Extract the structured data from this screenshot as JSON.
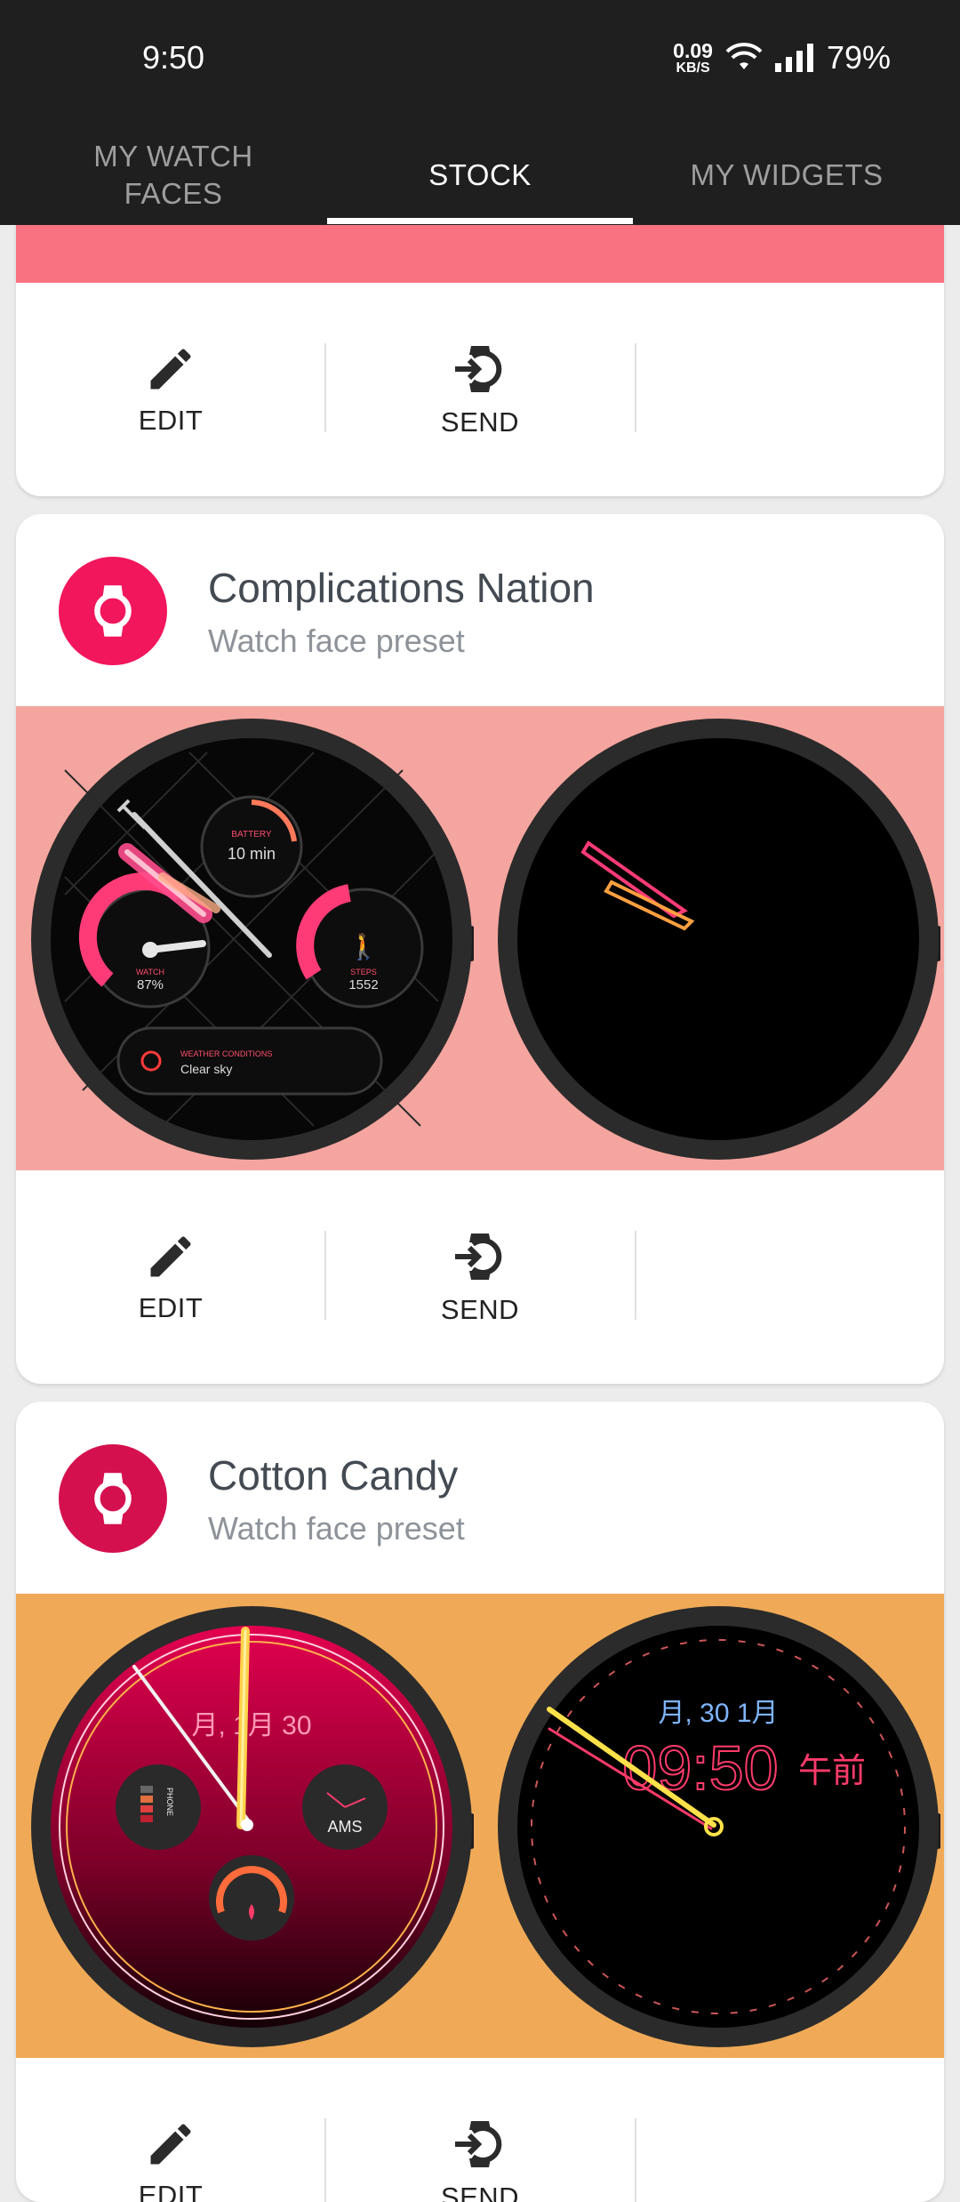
{
  "status_bar": {
    "time": "9:50",
    "net_speed_value": "0.09",
    "net_speed_unit": "KB/S",
    "battery": "79%"
  },
  "tabs": [
    {
      "label": "MY WATCH FACES",
      "active": false
    },
    {
      "label": "STOCK",
      "active": true
    },
    {
      "label": "MY WIDGETS",
      "active": false
    }
  ],
  "cards": [
    {
      "title": "",
      "subtitle": "",
      "preview_bg": "#f97282",
      "actions": {
        "edit": "EDIT",
        "send": "SEND"
      }
    },
    {
      "title": "Complications Nation",
      "subtitle": "Watch face preset",
      "avatar_color": "#f2165c",
      "preview_bg": "#f5a59f",
      "actions": {
        "edit": "EDIT",
        "send": "SEND"
      },
      "watch_texts": {
        "battery_label": "BATTERY",
        "battery_value": "10 min",
        "watch_label": "WATCH",
        "watch_value": "87%",
        "steps_label": "STEPS",
        "steps_value": "1552",
        "weather_label": "WEATHER CONDITIONS",
        "weather_value": "Clear sky"
      }
    },
    {
      "title": "Cotton Candy",
      "subtitle": "Watch face preset",
      "avatar_color": "#d5104f",
      "preview_bg": "#f0aa57",
      "actions": {
        "edit": "EDIT",
        "send": "SEND"
      },
      "watch_texts": {
        "date_left": "月, 1月 30",
        "phone_label": "PHONE",
        "ams_label": "AMS",
        "date_right": "月, 30 1月",
        "time": "09:50",
        "ampm": "午前"
      }
    }
  ],
  "icons": [
    "pencil-icon",
    "send-to-watch-icon",
    "watch-icon",
    "wifi-icon",
    "signal-icon"
  ]
}
